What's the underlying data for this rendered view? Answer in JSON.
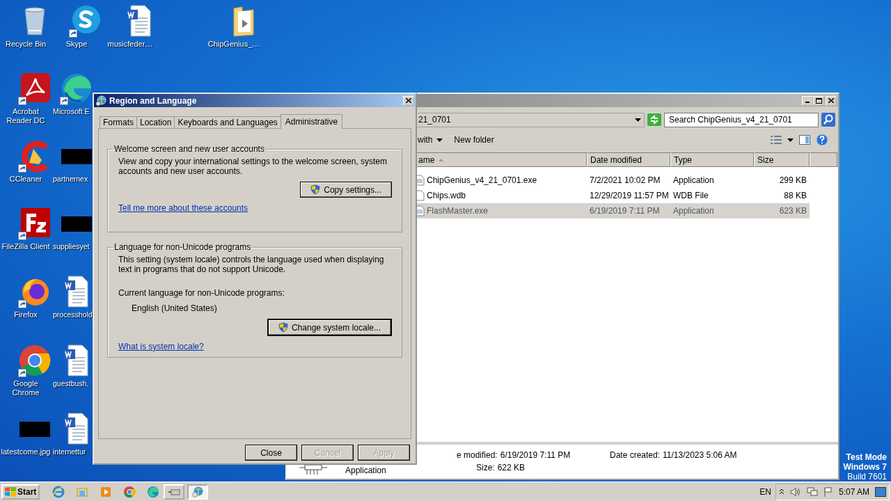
{
  "desktop": {
    "icons": [
      {
        "label": "Recycle Bin",
        "kind": "bin",
        "shortcut": false
      },
      {
        "label": "Skype",
        "kind": "skype",
        "shortcut": true
      },
      {
        "label": "musicfeder…",
        "kind": "doc",
        "shortcut": false
      },
      {
        "label": "ChipGenius_…",
        "kind": "folder",
        "shortcut": false
      },
      {
        "label": "Acrobat Reader DC",
        "kind": "pdf",
        "shortcut": true
      },
      {
        "label": "Microsoft E",
        "kind": "edge",
        "shortcut": true
      },
      {
        "label": "CCleaner",
        "kind": "ccleaner",
        "shortcut": true
      },
      {
        "label": "partnernex",
        "kind": "thumb",
        "shortcut": false
      },
      {
        "label": "FileZilla Client",
        "kind": "filezilla",
        "shortcut": true
      },
      {
        "label": "suppliesyet",
        "kind": "thumb",
        "shortcut": false
      },
      {
        "label": "Firefox",
        "kind": "firefox",
        "shortcut": true
      },
      {
        "label": "processhold",
        "kind": "doc",
        "shortcut": false
      },
      {
        "label": "Google Chrome",
        "kind": "chrome",
        "shortcut": true
      },
      {
        "label": "guestbush.",
        "kind": "doc",
        "shortcut": false
      },
      {
        "label": "latestcome.jpg",
        "kind": "thumb",
        "shortcut": false
      },
      {
        "label": "internettur",
        "kind": "doc",
        "shortcut": false
      }
    ],
    "os_notice": [
      "Test Mode",
      "Windows 7",
      "Build 7601"
    ]
  },
  "explorer": {
    "address": "21_0701",
    "search": {
      "placeholder": "Search ChipGenius_v4_21_0701"
    },
    "toolbar": [
      {
        "label": "with",
        "menu": true
      },
      {
        "label": "New folder",
        "menu": false
      }
    ],
    "columns": [
      {
        "label": "ame",
        "sorted": true
      },
      {
        "label": "Date modified",
        "sorted": false
      },
      {
        "label": "Type",
        "sorted": false
      },
      {
        "label": "Size",
        "sorted": false
      }
    ],
    "files": [
      {
        "name": "ChipGenius_v4_21_0701.exe",
        "kind": "exe",
        "date": "7/2/2021 10:02 PM",
        "type": "Application",
        "size": "299 KB",
        "selected": false
      },
      {
        "name": "Chips.wdb",
        "kind": "file",
        "date": "12/29/2019 11:57 PM",
        "type": "WDB File",
        "size": "88 KB",
        "selected": false
      },
      {
        "name": "FlashMaster.exe",
        "kind": "exe",
        "date": "6/19/2019 7:11 PM",
        "type": "Application",
        "size": "623 KB",
        "selected": true
      }
    ],
    "details": {
      "type": "Application",
      "fields": [
        {
          "label": "e modified:",
          "value": "6/19/2019 7:11 PM"
        },
        {
          "label": "Size:",
          "value": "622 KB"
        },
        {
          "label": "Date created:",
          "value": "11/13/2023 5:06 AM"
        }
      ]
    }
  },
  "dialog": {
    "title": "Region and Language",
    "tabs": [
      {
        "label": "Formats",
        "selected": false
      },
      {
        "label": "Location",
        "selected": false
      },
      {
        "label": "Keyboards and Languages",
        "selected": false
      },
      {
        "label": "Administrative",
        "selected": true
      }
    ],
    "groups": [
      {
        "title": "Welcome screen and new user accounts",
        "items": [
          {
            "kind": "text",
            "text": "View and copy your international settings to the welcome screen, system accounts and new user accounts."
          },
          {
            "kind": "button",
            "text": "Copy settings...",
            "default": false
          },
          {
            "kind": "link",
            "text": "Tell me more about these accounts"
          }
        ]
      },
      {
        "title": "Language for non-Unicode programs",
        "items": [
          {
            "kind": "text",
            "text": "This setting (system locale) controls the language used when displaying text in programs that do not support Unicode."
          },
          {
            "kind": "label",
            "text": "Current language for non-Unicode programs:"
          },
          {
            "kind": "value",
            "text": "English (United States)"
          },
          {
            "kind": "button",
            "text": "Change system locale...",
            "default": true
          },
          {
            "kind": "link",
            "text": "What is system locale?"
          }
        ]
      }
    ],
    "buttons": [
      {
        "label": "Close",
        "disabled": false
      },
      {
        "label": "Cancel",
        "disabled": true
      },
      {
        "label": "Apply",
        "disabled": true
      }
    ]
  },
  "taskbar": {
    "start": "Start",
    "quick_launch": [
      {
        "kind": "ie"
      },
      {
        "kind": "folder"
      },
      {
        "kind": "media"
      },
      {
        "kind": "chrome"
      },
      {
        "kind": "edge"
      }
    ],
    "tasks": [
      {
        "kind": "drive",
        "selected": false
      },
      {
        "kind": "globe",
        "selected": true
      }
    ],
    "language": "EN",
    "clock": "5:07 AM"
  }
}
